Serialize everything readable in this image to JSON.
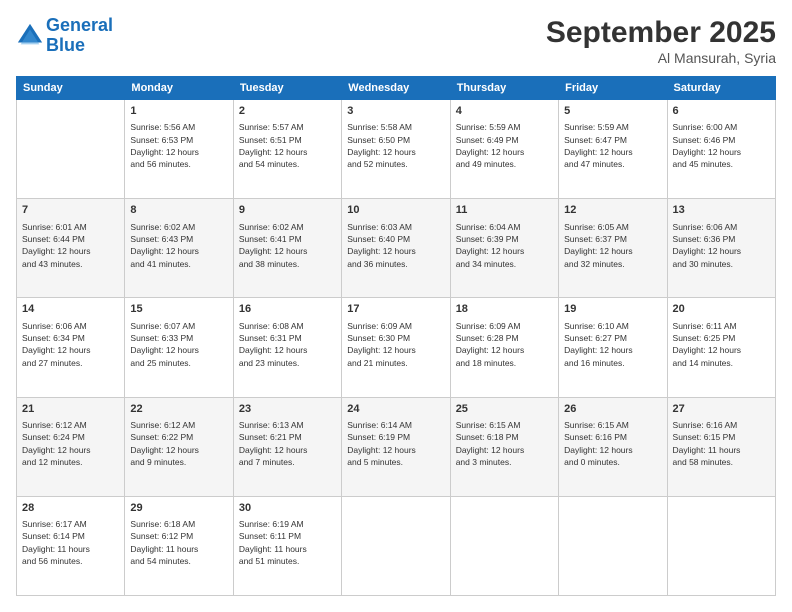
{
  "logo": {
    "line1": "General",
    "line2": "Blue"
  },
  "title": "September 2025",
  "location": "Al Mansurah, Syria",
  "days_header": [
    "Sunday",
    "Monday",
    "Tuesday",
    "Wednesday",
    "Thursday",
    "Friday",
    "Saturday"
  ],
  "weeks": [
    [
      {
        "num": "",
        "info": ""
      },
      {
        "num": "1",
        "info": "Sunrise: 5:56 AM\nSunset: 6:53 PM\nDaylight: 12 hours\nand 56 minutes."
      },
      {
        "num": "2",
        "info": "Sunrise: 5:57 AM\nSunset: 6:51 PM\nDaylight: 12 hours\nand 54 minutes."
      },
      {
        "num": "3",
        "info": "Sunrise: 5:58 AM\nSunset: 6:50 PM\nDaylight: 12 hours\nand 52 minutes."
      },
      {
        "num": "4",
        "info": "Sunrise: 5:59 AM\nSunset: 6:49 PM\nDaylight: 12 hours\nand 49 minutes."
      },
      {
        "num": "5",
        "info": "Sunrise: 5:59 AM\nSunset: 6:47 PM\nDaylight: 12 hours\nand 47 minutes."
      },
      {
        "num": "6",
        "info": "Sunrise: 6:00 AM\nSunset: 6:46 PM\nDaylight: 12 hours\nand 45 minutes."
      }
    ],
    [
      {
        "num": "7",
        "info": "Sunrise: 6:01 AM\nSunset: 6:44 PM\nDaylight: 12 hours\nand 43 minutes."
      },
      {
        "num": "8",
        "info": "Sunrise: 6:02 AM\nSunset: 6:43 PM\nDaylight: 12 hours\nand 41 minutes."
      },
      {
        "num": "9",
        "info": "Sunrise: 6:02 AM\nSunset: 6:41 PM\nDaylight: 12 hours\nand 38 minutes."
      },
      {
        "num": "10",
        "info": "Sunrise: 6:03 AM\nSunset: 6:40 PM\nDaylight: 12 hours\nand 36 minutes."
      },
      {
        "num": "11",
        "info": "Sunrise: 6:04 AM\nSunset: 6:39 PM\nDaylight: 12 hours\nand 34 minutes."
      },
      {
        "num": "12",
        "info": "Sunrise: 6:05 AM\nSunset: 6:37 PM\nDaylight: 12 hours\nand 32 minutes."
      },
      {
        "num": "13",
        "info": "Sunrise: 6:06 AM\nSunset: 6:36 PM\nDaylight: 12 hours\nand 30 minutes."
      }
    ],
    [
      {
        "num": "14",
        "info": "Sunrise: 6:06 AM\nSunset: 6:34 PM\nDaylight: 12 hours\nand 27 minutes."
      },
      {
        "num": "15",
        "info": "Sunrise: 6:07 AM\nSunset: 6:33 PM\nDaylight: 12 hours\nand 25 minutes."
      },
      {
        "num": "16",
        "info": "Sunrise: 6:08 AM\nSunset: 6:31 PM\nDaylight: 12 hours\nand 23 minutes."
      },
      {
        "num": "17",
        "info": "Sunrise: 6:09 AM\nSunset: 6:30 PM\nDaylight: 12 hours\nand 21 minutes."
      },
      {
        "num": "18",
        "info": "Sunrise: 6:09 AM\nSunset: 6:28 PM\nDaylight: 12 hours\nand 18 minutes."
      },
      {
        "num": "19",
        "info": "Sunrise: 6:10 AM\nSunset: 6:27 PM\nDaylight: 12 hours\nand 16 minutes."
      },
      {
        "num": "20",
        "info": "Sunrise: 6:11 AM\nSunset: 6:25 PM\nDaylight: 12 hours\nand 14 minutes."
      }
    ],
    [
      {
        "num": "21",
        "info": "Sunrise: 6:12 AM\nSunset: 6:24 PM\nDaylight: 12 hours\nand 12 minutes."
      },
      {
        "num": "22",
        "info": "Sunrise: 6:12 AM\nSunset: 6:22 PM\nDaylight: 12 hours\nand 9 minutes."
      },
      {
        "num": "23",
        "info": "Sunrise: 6:13 AM\nSunset: 6:21 PM\nDaylight: 12 hours\nand 7 minutes."
      },
      {
        "num": "24",
        "info": "Sunrise: 6:14 AM\nSunset: 6:19 PM\nDaylight: 12 hours\nand 5 minutes."
      },
      {
        "num": "25",
        "info": "Sunrise: 6:15 AM\nSunset: 6:18 PM\nDaylight: 12 hours\nand 3 minutes."
      },
      {
        "num": "26",
        "info": "Sunrise: 6:15 AM\nSunset: 6:16 PM\nDaylight: 12 hours\nand 0 minutes."
      },
      {
        "num": "27",
        "info": "Sunrise: 6:16 AM\nSunset: 6:15 PM\nDaylight: 11 hours\nand 58 minutes."
      }
    ],
    [
      {
        "num": "28",
        "info": "Sunrise: 6:17 AM\nSunset: 6:14 PM\nDaylight: 11 hours\nand 56 minutes."
      },
      {
        "num": "29",
        "info": "Sunrise: 6:18 AM\nSunset: 6:12 PM\nDaylight: 11 hours\nand 54 minutes."
      },
      {
        "num": "30",
        "info": "Sunrise: 6:19 AM\nSunset: 6:11 PM\nDaylight: 11 hours\nand 51 minutes."
      },
      {
        "num": "",
        "info": ""
      },
      {
        "num": "",
        "info": ""
      },
      {
        "num": "",
        "info": ""
      },
      {
        "num": "",
        "info": ""
      }
    ]
  ]
}
